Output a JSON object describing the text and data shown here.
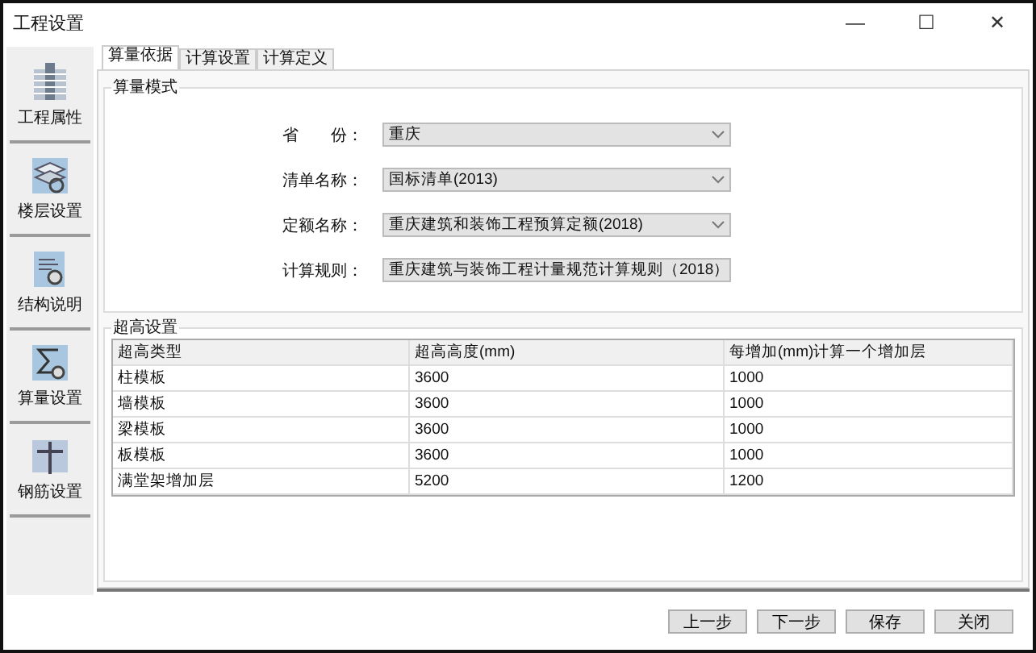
{
  "window": {
    "title": "工程设置",
    "controls": [
      "—",
      "☐",
      "✕"
    ]
  },
  "sidebar": {
    "items": [
      {
        "label": "工程属性",
        "kind": "building"
      },
      {
        "label": "楼层设置",
        "kind": "floors"
      },
      {
        "label": "结构说明",
        "kind": "document"
      },
      {
        "label": "算量设置",
        "kind": "sigma"
      },
      {
        "label": "钢筋设置",
        "kind": "rebar"
      }
    ]
  },
  "tabs": [
    {
      "label": "算量依据",
      "selected": true
    },
    {
      "label": "计算设置",
      "selected": false
    },
    {
      "label": "计算定义",
      "selected": false
    }
  ],
  "mode_group": {
    "title": "算量模式",
    "fields": [
      {
        "label": "省　　份：",
        "value": "重庆"
      },
      {
        "label": "清单名称：",
        "value": "国标清单(2013)"
      },
      {
        "label": "定额名称：",
        "value": "重庆建筑和装饰工程预算定额(2018)"
      },
      {
        "label": "计算规则：",
        "value": "重庆建筑与装饰工程计量规范计算规则（2018）"
      }
    ]
  },
  "height_group": {
    "title": "超高设置",
    "table": {
      "columns": [
        "超高类型",
        "超高高度(mm)",
        "每增加(mm)计算一个增加层"
      ],
      "rows": [
        [
          "柱模板",
          "3600",
          "1000"
        ],
        [
          "墙模板",
          "3600",
          "1000"
        ],
        [
          "梁模板",
          "3600",
          "1000"
        ],
        [
          "板模板",
          "3600",
          "1000"
        ],
        [
          "满堂架增加层",
          "5200",
          "1200"
        ]
      ]
    }
  },
  "buttons": [
    "上一步",
    "下一步",
    "保存",
    "关闭"
  ]
}
